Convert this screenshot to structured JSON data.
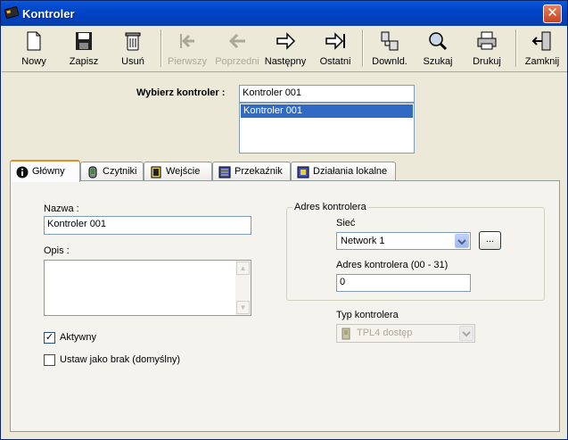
{
  "window": {
    "title": "Kontroler"
  },
  "toolbar": {
    "new_label": "Nowy",
    "save_label": "Zapisz",
    "delete_label": "Usuń",
    "first_label": "Pierwszy",
    "prev_label": "Poprzedni",
    "next_label": "Następny",
    "last_label": "Ostatni",
    "download_label": "Downld.",
    "search_label": "Szukaj",
    "print_label": "Drukuj",
    "close_label": "Zamknij"
  },
  "selector": {
    "label": "Wybierz kontroler :",
    "value": "Kontroler 001",
    "items": [
      "Kontroler 001"
    ]
  },
  "tabs": [
    {
      "label": "Główny",
      "icon": "info-icon"
    },
    {
      "label": "Czytniki",
      "icon": "reader-icon"
    },
    {
      "label": "Wejście",
      "icon": "input-icon"
    },
    {
      "label": "Przekaźnik",
      "icon": "relay-icon"
    },
    {
      "label": "Działania lokalne",
      "icon": "local-actions-icon"
    }
  ],
  "main": {
    "name_label": "Nazwa :",
    "name_value": "Kontroler 001",
    "desc_label": "Opis :",
    "desc_value": "",
    "active_label": "Aktywny",
    "active_checked": true,
    "default_label": "Ustaw jako brak (domyślny)",
    "default_checked": false
  },
  "address": {
    "group_label": "Adres kontrolera",
    "network_label": "Sieć",
    "network_value": "Network 1",
    "ellipsis_label": "...",
    "address_label": "Adres kontrolera (00 - 31)",
    "address_value": "0"
  },
  "type": {
    "label": "Typ kontrolera",
    "value": "TPL4 dostęp"
  },
  "colors": {
    "titlebar": "#0045c8",
    "selection": "#316ac5",
    "active_tab_accent": "#e68b2c"
  }
}
